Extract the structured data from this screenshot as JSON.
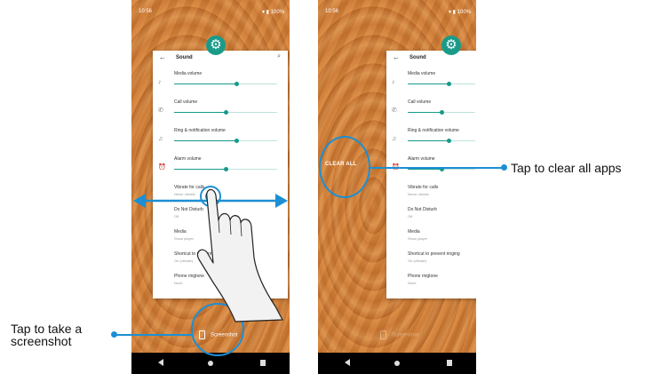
{
  "status_bar": {
    "time": "10:56",
    "battery": "100%"
  },
  "settings": {
    "title": "Sound",
    "rows": [
      {
        "label": "Media volume",
        "icon": "music-note-icon",
        "type": "slider",
        "value": 0.6
      },
      {
        "label": "Call volume",
        "icon": "phone-icon",
        "type": "slider",
        "value": 0.5
      },
      {
        "label": "Ring & notification volume",
        "icon": "bell-icon",
        "type": "slider",
        "value": 0.6
      },
      {
        "label": "Alarm volume",
        "icon": "alarm-icon",
        "type": "slider",
        "value": 0.5
      },
      {
        "label": "Vibrate for calls",
        "sub": "Never vibrate"
      },
      {
        "label": "Do Not Disturb",
        "sub": "Off"
      },
      {
        "label": "Media",
        "sub": "Show player"
      },
      {
        "label": "Shortcut to prevent ringing",
        "sub": "On (vibrate)"
      },
      {
        "label": "Phone ringtone",
        "sub": "None"
      }
    ]
  },
  "left_screen": {
    "screenshot_label": "Screenshot"
  },
  "right_screen": {
    "clear_all_label": "CLEAR ALL",
    "screenshot_label": "Screenshot"
  },
  "callouts": {
    "screenshot": "Tap to take a screenshot",
    "clear_all": "Tap to clear all apps"
  },
  "colors": {
    "accent": "#1b8fd4",
    "teal": "#159a89",
    "wallpaper": "#d0813a"
  }
}
